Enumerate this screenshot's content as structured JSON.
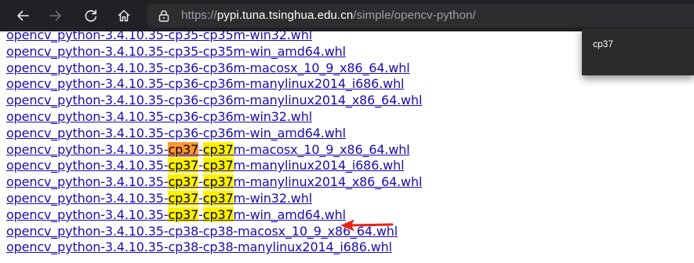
{
  "browser": {
    "url_scheme": "https://",
    "url_host": "pypi.tuna.tsinghua.edu.cn",
    "url_path": "/simple/opencv-python/"
  },
  "find": {
    "query": "cp37"
  },
  "links": [
    {
      "parts": [
        "opencv_python-3.4.10.35-cp35-cp35m-win32.whl"
      ]
    },
    {
      "parts": [
        "opencv_python-3.4.10.35-cp35-cp35m-win_amd64.whl"
      ]
    },
    {
      "parts": [
        "opencv_python-3.4.10.35-cp36-cp36m-macosx_10_9_x86_64.whl"
      ]
    },
    {
      "parts": [
        "opencv_python-3.4.10.35-cp36-cp36m-manylinux2014_i686.whl"
      ]
    },
    {
      "parts": [
        "opencv_python-3.4.10.35-cp36-cp36m-manylinux2014_x86_64.whl"
      ]
    },
    {
      "parts": [
        "opencv_python-3.4.10.35-cp36-cp36m-win32.whl"
      ]
    },
    {
      "parts": [
        "opencv_python-3.4.10.35-cp36-cp36m-win_amd64.whl"
      ]
    },
    {
      "parts": [
        "opencv_python-3.4.10.35-",
        "cp37",
        "-",
        "cp37",
        "m-macosx_10_9_x86_64.whl"
      ],
      "active": true
    },
    {
      "parts": [
        "opencv_python-3.4.10.35-",
        "cp37",
        "-",
        "cp37",
        "m-manylinux2014_i686.whl"
      ]
    },
    {
      "parts": [
        "opencv_python-3.4.10.35-",
        "cp37",
        "-",
        "cp37",
        "m-manylinux2014_x86_64.whl"
      ]
    },
    {
      "parts": [
        "opencv_python-3.4.10.35-",
        "cp37",
        "-",
        "cp37",
        "m-win32.whl"
      ]
    },
    {
      "parts": [
        "opencv_python-3.4.10.35-",
        "cp37",
        "-",
        "cp37",
        "m-win_amd64.whl"
      ]
    },
    {
      "parts": [
        "opencv_python-3.4.10.35-cp38-cp38-macosx_10_9_x86_64.whl"
      ]
    },
    {
      "parts": [
        "opencv_python-3.4.10.35-cp38-cp38-manylinux2014_i686.whl"
      ]
    }
  ],
  "icons": {
    "back": "back-arrow-icon",
    "forward": "forward-arrow-icon",
    "reload": "reload-icon",
    "home": "home-icon",
    "lock": "lock-icon",
    "annotation": "red-arrow-annotation"
  },
  "colors": {
    "toolbar": "#202124",
    "link": "#1a0dab",
    "highlight": "#fff200",
    "active_highlight": "#ff9632",
    "annotation": "#e8221b"
  }
}
